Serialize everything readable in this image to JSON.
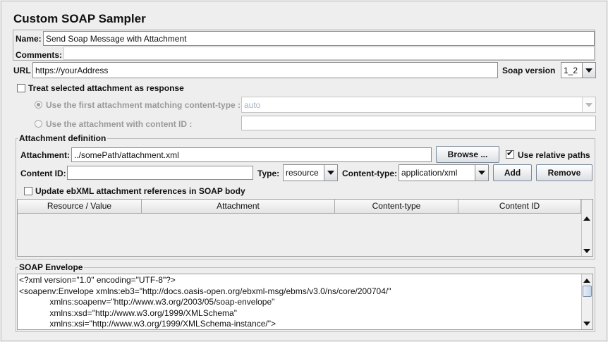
{
  "panel": {
    "title": "Custom SOAP Sampler"
  },
  "name_field": {
    "label": "Name:",
    "value": "Send Soap Message with Attachment"
  },
  "comments_field": {
    "label": "Comments:",
    "value": ""
  },
  "url_field": {
    "label": "URL",
    "value": "https://yourAddress"
  },
  "soap_version": {
    "label": "Soap version",
    "selected": "1_2"
  },
  "treat_attachment": {
    "label": "Treat selected attachment as response",
    "checked": false
  },
  "first_attachment_option": {
    "label": "Use the first attachment matching content-type :",
    "selected": true,
    "value": "auto"
  },
  "content_id_option": {
    "label": "Use the attachment with content ID :",
    "selected": false,
    "value": ""
  },
  "attachment_definition": {
    "title": "Attachment definition",
    "attachment_label": "Attachment:",
    "attachment_value": "../somePath/attachment.xml",
    "browse_label": "Browse ...",
    "use_relative_label": "Use relative paths",
    "use_relative_checked": true,
    "content_id_label": "Content ID:",
    "content_id_value": "",
    "type_label": "Type:",
    "type_selected": "resource",
    "content_type_label": "Content-type:",
    "content_type_selected": "application/xml",
    "add_label": "Add",
    "remove_label": "Remove",
    "update_ebxml_label": "Update ebXML attachment references in SOAP body",
    "update_ebxml_checked": false,
    "table": {
      "columns": [
        "Resource / Value",
        "Attachment",
        "Content-type",
        "Content ID"
      ],
      "rows": []
    }
  },
  "soap_envelope": {
    "title": "SOAP Envelope",
    "lines": [
      "<?xml version=\"1.0\" encoding=\"UTF-8\"?>",
      "<soapenv:Envelope xmlns:eb3=\"http://docs.oasis-open.org/ebxml-msg/ebms/v3.0/ns/core/200704/\"",
      "             xmlns:soapenv=\"http://www.w3.org/2003/05/soap-envelope\"",
      "             xmlns:xsd=\"http://www.w3.org/1999/XMLSchema\"",
      "             xmlns:xsi=\"http://www.w3.org/1999/XMLSchema-instance/\">"
    ]
  },
  "icons": {
    "checkbox": "checkbox-icon",
    "radio": "radio-icon",
    "dropdown": "chevron-down-icon",
    "scroll_up": "scroll-up-icon",
    "scroll_down": "scroll-down-icon"
  }
}
